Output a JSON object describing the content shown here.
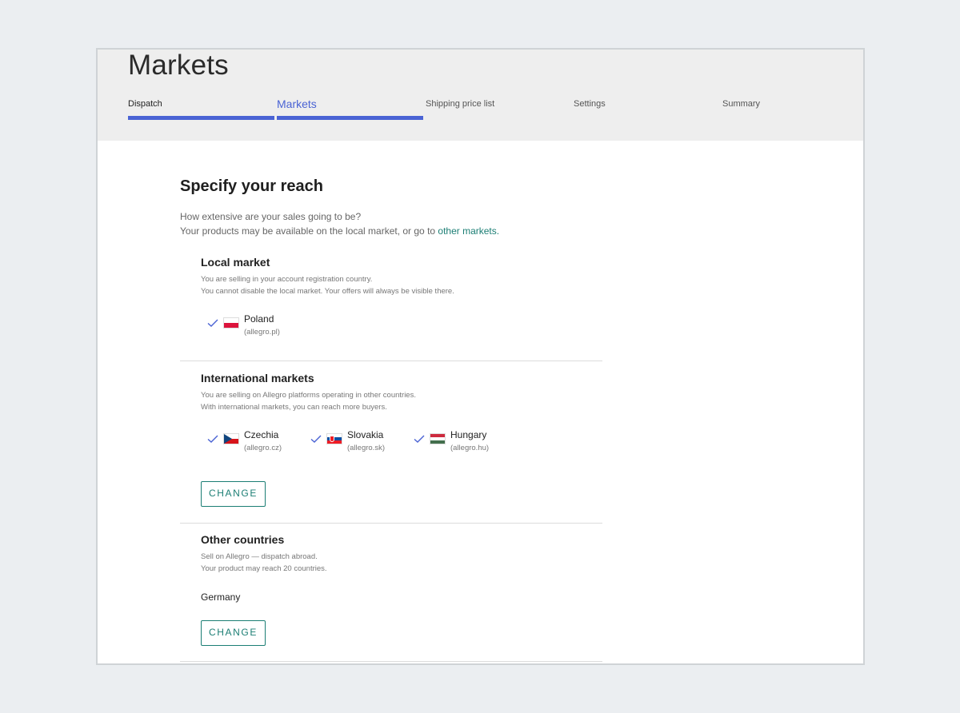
{
  "header": {
    "title": "Markets",
    "steps": [
      {
        "label": "Dispatch"
      },
      {
        "label": "Markets"
      },
      {
        "label": "Shipping price list"
      },
      {
        "label": "Settings"
      },
      {
        "label": "Summary"
      }
    ]
  },
  "reach": {
    "title": "Specify your reach",
    "intro_line1": "How extensive are your sales going to be?",
    "intro_line2_prefix": "Your products may be available on the local market, or go to ",
    "intro_link": "other markets.",
    "local": {
      "title": "Local market",
      "desc_line1": "You are selling in your account registration country.",
      "desc_line2": "You cannot disable the local market. Your offers will always be visible there.",
      "markets": [
        {
          "name": "Poland",
          "domain": "(allegro.pl)"
        }
      ]
    },
    "international": {
      "title": "International markets",
      "desc_line1": "You are selling on Allegro platforms operating in other countries.",
      "desc_line2": "With international markets, you can reach more buyers.",
      "markets": [
        {
          "name": "Czechia",
          "domain": "(allegro.cz)"
        },
        {
          "name": "Slovakia",
          "domain": "(allegro.sk)"
        },
        {
          "name": "Hungary",
          "domain": "(allegro.hu)"
        }
      ],
      "button_label": "CHANGE"
    },
    "other": {
      "title": "Other countries",
      "desc_line1": "Sell on Allegro — dispatch abroad.",
      "desc_line2": "Your product may reach 20 countries.",
      "country": "Germany",
      "button_label": "CHANGE"
    }
  },
  "colors": {
    "accent": "#4a63d4",
    "link": "#1b7e74",
    "check": "#4a63d4"
  }
}
